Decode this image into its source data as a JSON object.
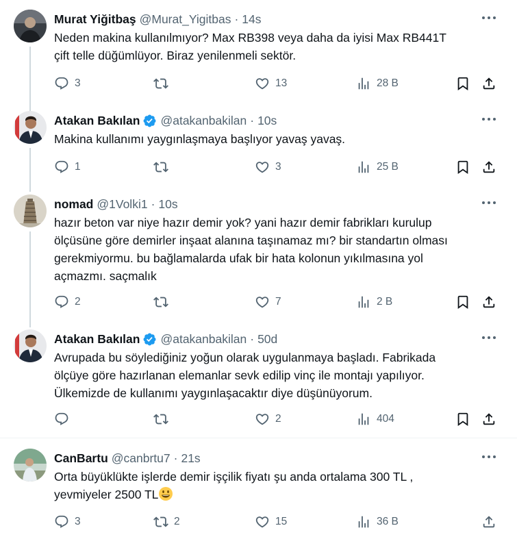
{
  "tweets": [
    {
      "name": "Murat Yiğitbaş",
      "handle": "@Murat_Yigitbas",
      "time": "14s",
      "verified": false,
      "lines": [
        "Neden makina kullanılmıyor?  Max RB398 veya daha da iyisi Max RB441T",
        "çift telle düğümlüyor. Biraz yenilenmeli sektör."
      ],
      "replies": "3",
      "retweets": "",
      "likes": "13",
      "views": "28 B"
    },
    {
      "name": "Atakan Bakılan",
      "handle": "@atakanbakilan",
      "time": "10s",
      "verified": true,
      "lines": [
        "Makina kullanımı yaygınlaşmaya başlıyor yavaş yavaş."
      ],
      "replies": "1",
      "retweets": "",
      "likes": "3",
      "views": "25 B"
    },
    {
      "name": "nomad",
      "handle": "@1Volki1",
      "time": "10s",
      "verified": false,
      "lines": [
        "hazır beton var niye hazır demir yok? yani hazır demir fabrikları kurulup",
        "ölçüsüne göre demirler inşaat alanına taşınamaz mı?  bir standartın olması",
        "gerekmiyormu. bu bağlamalarda ufak bir hata kolonun yıkılmasına yol",
        "açmazmı. saçmalık"
      ],
      "replies": "2",
      "retweets": "",
      "likes": "7",
      "views": "2 B"
    },
    {
      "name": "Atakan Bakılan",
      "handle": "@atakanbakilan",
      "time": "50d",
      "verified": true,
      "lines": [
        "Avrupada bu söylediğiniz yoğun olarak uygulanmaya başladı. Fabrikada",
        "ölçüye göre hazırlanan elemanlar sevk edilip vinç ile montajı yapılıyor.",
        "Ülkemizde de kullanımı yaygınlaşacaktır diye düşünüyorum."
      ],
      "replies": "",
      "retweets": "",
      "likes": "2",
      "views": "404"
    },
    {
      "name": "CanBartu",
      "handle": "@canbrtu7",
      "time": "21s",
      "verified": false,
      "lines": [
        "Orta büyüklükte işlerde demir işçilik fiyatı şu anda ortalama 300 TL ,",
        "yevmiyeler 2500 TL"
      ],
      "replies": "3",
      "retweets": "2",
      "likes": "15",
      "views": "36 B"
    }
  ],
  "icons": {
    "reply": "reply-icon",
    "retweet": "retweet-icon",
    "like": "heart-icon",
    "views": "views-chart-icon",
    "bookmark": "bookmark-icon",
    "share": "share-icon",
    "more": "more-options-icon",
    "verified": "verified-badge-icon",
    "emoji": "grinning-face-emoji"
  },
  "colors": {
    "text": "#0f1419",
    "secondary": "#536471",
    "verified": "#1d9bf0",
    "thread_line": "#cfd9de",
    "divider": "#eff3f4",
    "emoji": "#ffcc4d"
  }
}
